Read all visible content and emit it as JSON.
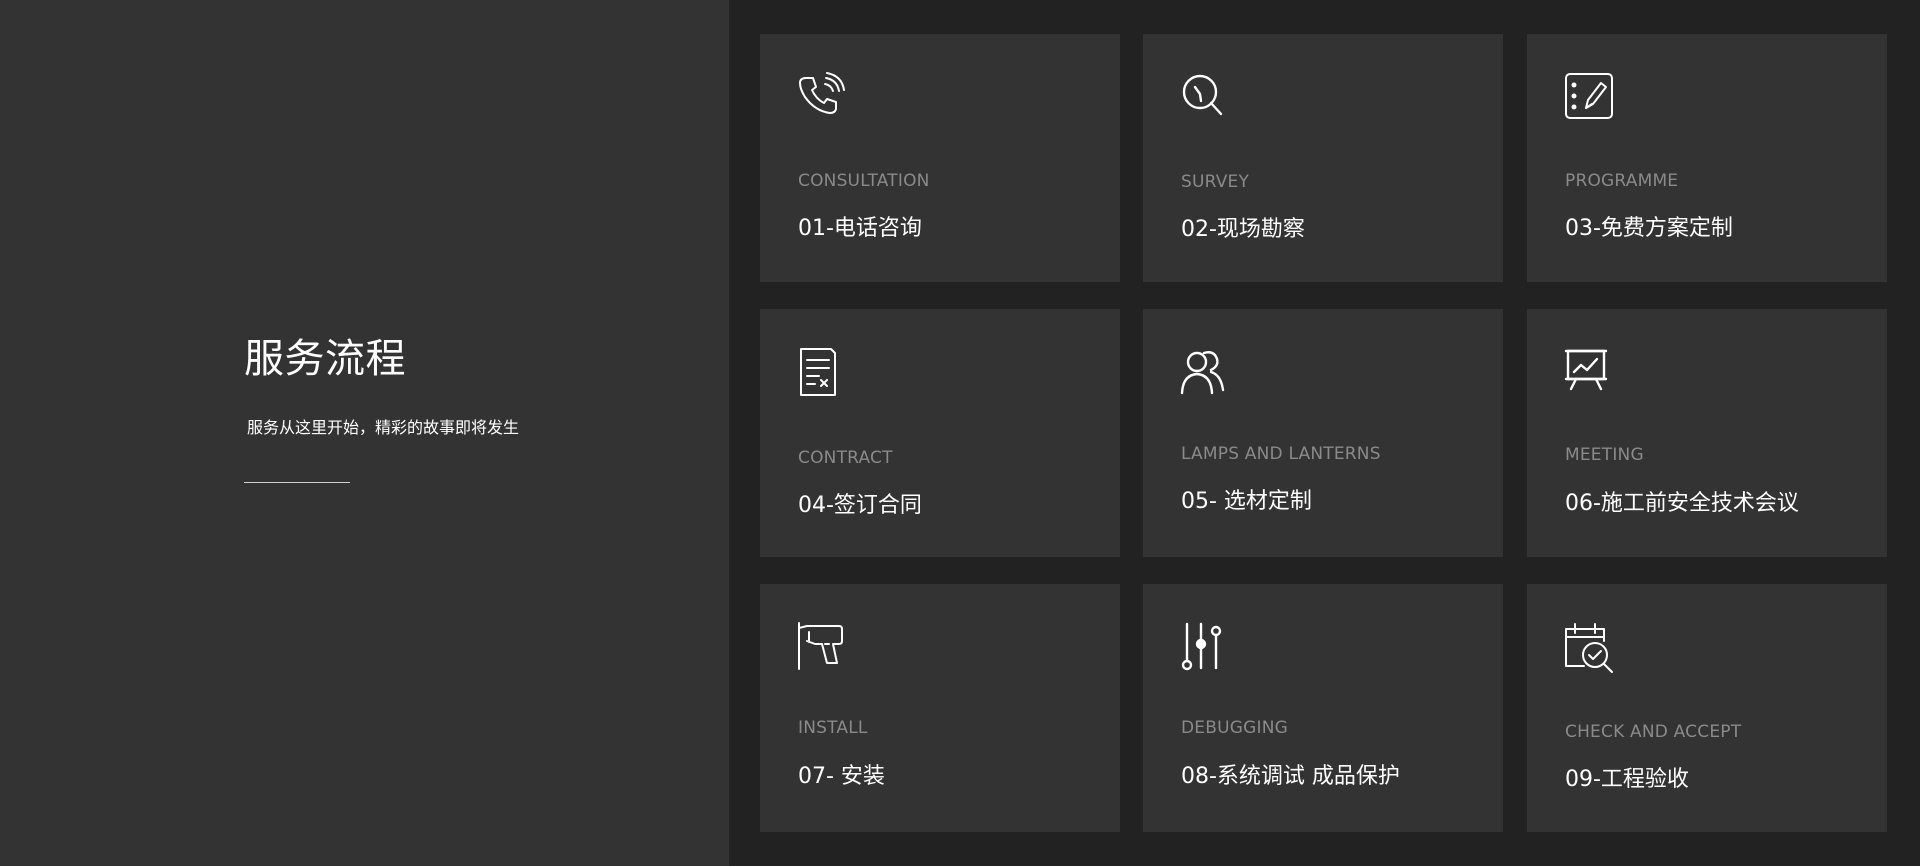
{
  "intro": {
    "title": "服务流程",
    "subtitle": "服务从这里开始，精彩的故事即将发生"
  },
  "colors": {
    "left_background": "#333333",
    "right_background": "#222222",
    "card_background": "#333333",
    "title_text": "#ffffff",
    "english_label": "#8a8a8a"
  },
  "steps": [
    {
      "en": "CONSULTATION",
      "cn": "01-电话咨询",
      "icon": "phone-icon"
    },
    {
      "en": "SURVEY",
      "cn": "02-现场勘察",
      "icon": "magnifier-icon"
    },
    {
      "en": "PROGRAMME",
      "cn": "03-免费方案定制",
      "icon": "edit-list-icon"
    },
    {
      "en": "CONTRACT",
      "cn": "04-签订合同",
      "icon": "contract-icon"
    },
    {
      "en": "LAMPS AND LANTERNS",
      "cn": "05- 选材定制",
      "icon": "users-icon"
    },
    {
      "en": "MEETING",
      "cn": "06-施工前安全技术会议",
      "icon": "presentation-board-icon"
    },
    {
      "en": "INSTALL",
      "cn": "07- 安装",
      "icon": "drill-icon"
    },
    {
      "en": "DEBUGGING",
      "cn": "08-系统调试 成品保护",
      "icon": "sliders-icon"
    },
    {
      "en": "CHECK AND ACCEPT",
      "cn": "09-工程验收",
      "icon": "calendar-check-icon"
    }
  ]
}
